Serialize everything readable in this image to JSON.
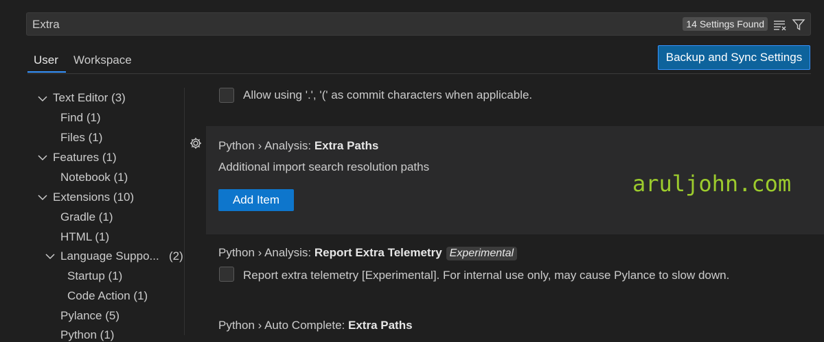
{
  "search": {
    "value": "Extra",
    "results_badge": "14 Settings Found"
  },
  "tabs": {
    "user": "User",
    "workspace": "Workspace"
  },
  "sync_button": "Backup and Sync Settings",
  "toc": [
    {
      "label": "Text Editor",
      "count": "(3)"
    },
    {
      "label": "Find",
      "count": "(1)"
    },
    {
      "label": "Files",
      "count": "(1)"
    },
    {
      "label": "Features",
      "count": "(1)"
    },
    {
      "label": "Notebook",
      "count": "(1)"
    },
    {
      "label": "Extensions",
      "count": "(10)"
    },
    {
      "label": "Gradle",
      "count": "(1)"
    },
    {
      "label": "HTML",
      "count": "(1)"
    },
    {
      "label": "Language Suppo...",
      "count": "(2)"
    },
    {
      "label": "Startup",
      "count": "(1)"
    },
    {
      "label": "Code Action",
      "count": "(1)"
    },
    {
      "label": "Pylance",
      "count": "(5)"
    },
    {
      "label": "Python",
      "count": "(1)"
    }
  ],
  "settings": {
    "commit_chars": {
      "description": "Allow using '.', '(' as commit characters when applicable."
    },
    "extra_paths": {
      "prefix": "Python › Analysis: ",
      "name": "Extra Paths",
      "description": "Additional import search resolution paths",
      "add_button": "Add Item"
    },
    "telemetry": {
      "prefix": "Python › Analysis: ",
      "name": "Report Extra Telemetry",
      "tag": "Experimental",
      "description": "Report extra telemetry [Experimental]. For internal use only, may cause Pylance to slow down."
    },
    "auto_complete": {
      "prefix": "Python › Auto Complete: ",
      "name": "Extra Paths"
    }
  },
  "watermark": "aruljohn.com",
  "colors": {
    "accent": "#0e639c",
    "button": "#0e76cc",
    "watermark": "#9ccb2d",
    "tab_underline": "#3794ff"
  }
}
